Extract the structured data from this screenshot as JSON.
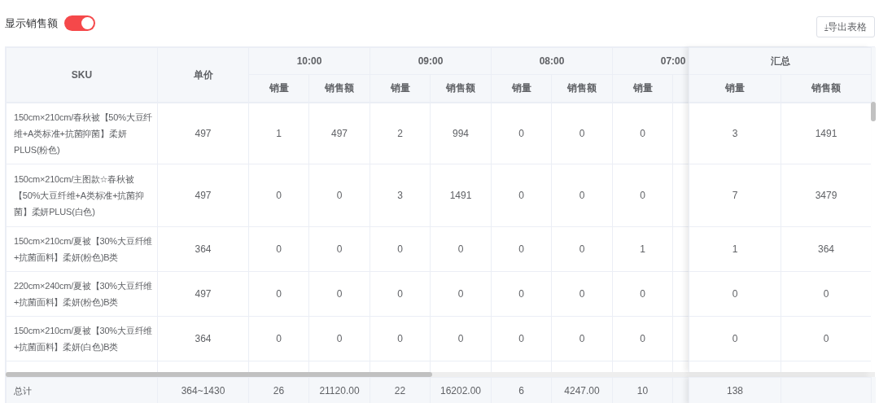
{
  "toggle": {
    "label": "显示销售额",
    "on": true
  },
  "export_button": {
    "icon": "⤓",
    "label": "导出表格"
  },
  "table": {
    "fixed_columns": [
      "SKU",
      "单价"
    ],
    "time_groups": [
      {
        "label": "10:00",
        "subcolumns": [
          "销量",
          "销售额"
        ]
      },
      {
        "label": "09:00",
        "subcolumns": [
          "销量",
          "销售额"
        ]
      },
      {
        "label": "08:00",
        "subcolumns": [
          "销量",
          "销售额"
        ]
      },
      {
        "label": "07:00",
        "subcolumns": [
          "销量"
        ]
      }
    ],
    "summary_group": {
      "label": "汇总",
      "subcolumns": [
        "销量",
        "销售额"
      ]
    },
    "rows": [
      {
        "sku": "150cm×210cm/春秋被【50%大豆纤维+A类标准+抗菌抑菌】柔妍PLUS(粉色)",
        "price": "497",
        "cells": [
          "1",
          "497",
          "2",
          "994",
          "0",
          "0",
          "0"
        ],
        "summary": [
          "3",
          "1491"
        ]
      },
      {
        "sku": "150cm×210cm/主图款☆春秋被【50%大豆纤维+A类标准+抗菌抑菌】柔妍PLUS(白色)",
        "price": "497",
        "cells": [
          "0",
          "0",
          "3",
          "1491",
          "0",
          "0",
          "0"
        ],
        "summary": [
          "7",
          "3479"
        ]
      },
      {
        "sku": "150cm×210cm/夏被【30%大豆纤维+抗菌面料】柔妍(粉色)B类",
        "price": "364",
        "cells": [
          "0",
          "0",
          "0",
          "0",
          "0",
          "0",
          "1"
        ],
        "summary": [
          "1",
          "364"
        ]
      },
      {
        "sku": "220cm×240cm/夏被【30%大豆纤维+抗菌面料】柔妍(粉色)B类",
        "price": "497",
        "cells": [
          "0",
          "0",
          "0",
          "0",
          "0",
          "0",
          "0"
        ],
        "summary": [
          "0",
          "0"
        ]
      },
      {
        "sku": "150cm×210cm/夏被【30%大豆纤维+抗菌面料】柔妍(白色)B类",
        "price": "364",
        "cells": [
          "0",
          "0",
          "0",
          "0",
          "0",
          "0",
          "0"
        ],
        "summary": [
          "0",
          "0"
        ]
      }
    ],
    "footer": {
      "label": "总计",
      "price": "364~1430",
      "cells": [
        "26",
        "21120.00",
        "22",
        "16202.00",
        "6",
        "4247.00",
        "10"
      ],
      "summary": [
        "138"
      ]
    }
  }
}
